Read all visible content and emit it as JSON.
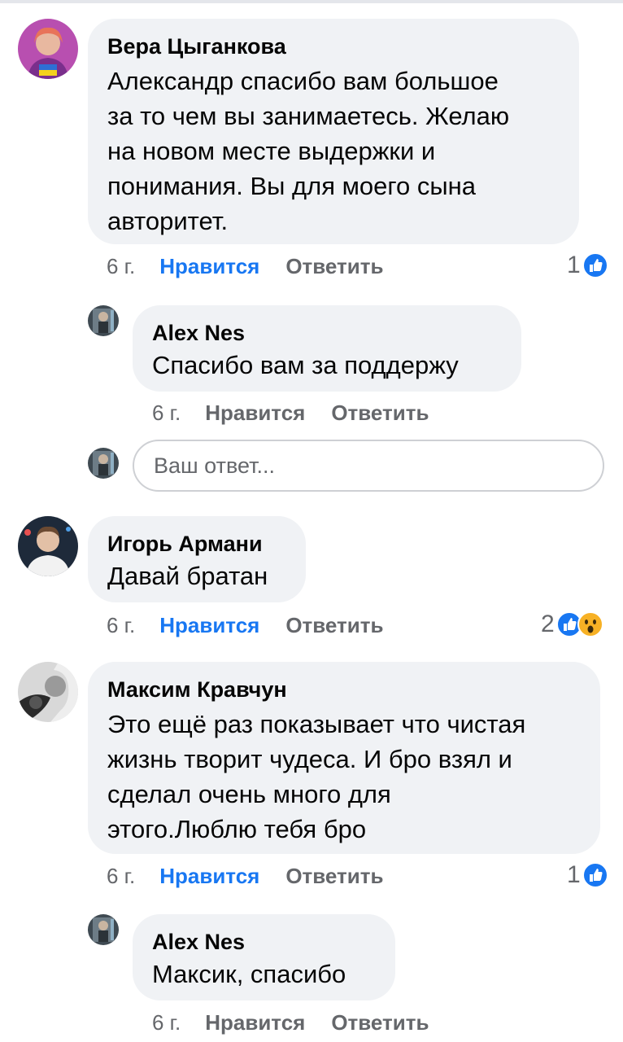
{
  "comments": [
    {
      "author": "Вера Цыганкова",
      "lines": [
        "Александр спасибо вам большое",
        "за то чем вы занимаетесь. Желаю",
        "на новом месте выдержки и",
        "понимания. Вы для моего сына",
        "авторитет."
      ],
      "time": "6 г.",
      "like_label": "Нравится",
      "reply_label": "Ответить",
      "reaction_count": "1",
      "reactions": [
        "like-icon"
      ],
      "reply": {
        "author": "Alex Nes",
        "lines": [
          "Спасибо вам за поддержу"
        ],
        "time": "6 г.",
        "like_label": "Нравится",
        "reply_label": "Ответить"
      }
    },
    {
      "author": "Игорь Армани",
      "lines": [
        "Давай братан"
      ],
      "time": "6 г.",
      "like_label": "Нравится",
      "reply_label": "Ответить",
      "reaction_count": "2",
      "reactions": [
        "like-icon",
        "wow-icon"
      ]
    },
    {
      "author": "Максим Кравчун",
      "lines": [
        "Это ещё раз показывает что чистая",
        "жизнь творит чудеса. И бро взял и",
        "сделал очень много для",
        "этого.Люблю тебя бро"
      ],
      "time": "6 г.",
      "like_label": "Нравится",
      "reply_label": "Ответить",
      "reaction_count": "1",
      "reactions": [
        "like-icon"
      ],
      "reply": {
        "author": "Alex Nes",
        "lines": [
          "Максик, спасибо"
        ],
        "time": "6 г.",
        "like_label": "Нравится",
        "reply_label": "Ответить"
      }
    }
  ],
  "reply_box": {
    "placeholder": "Ваш ответ..."
  },
  "colors": {
    "accent": "#1877f2",
    "bubble": "#f0f2f5",
    "muted": "#65676b",
    "wow": "#f7b125"
  }
}
